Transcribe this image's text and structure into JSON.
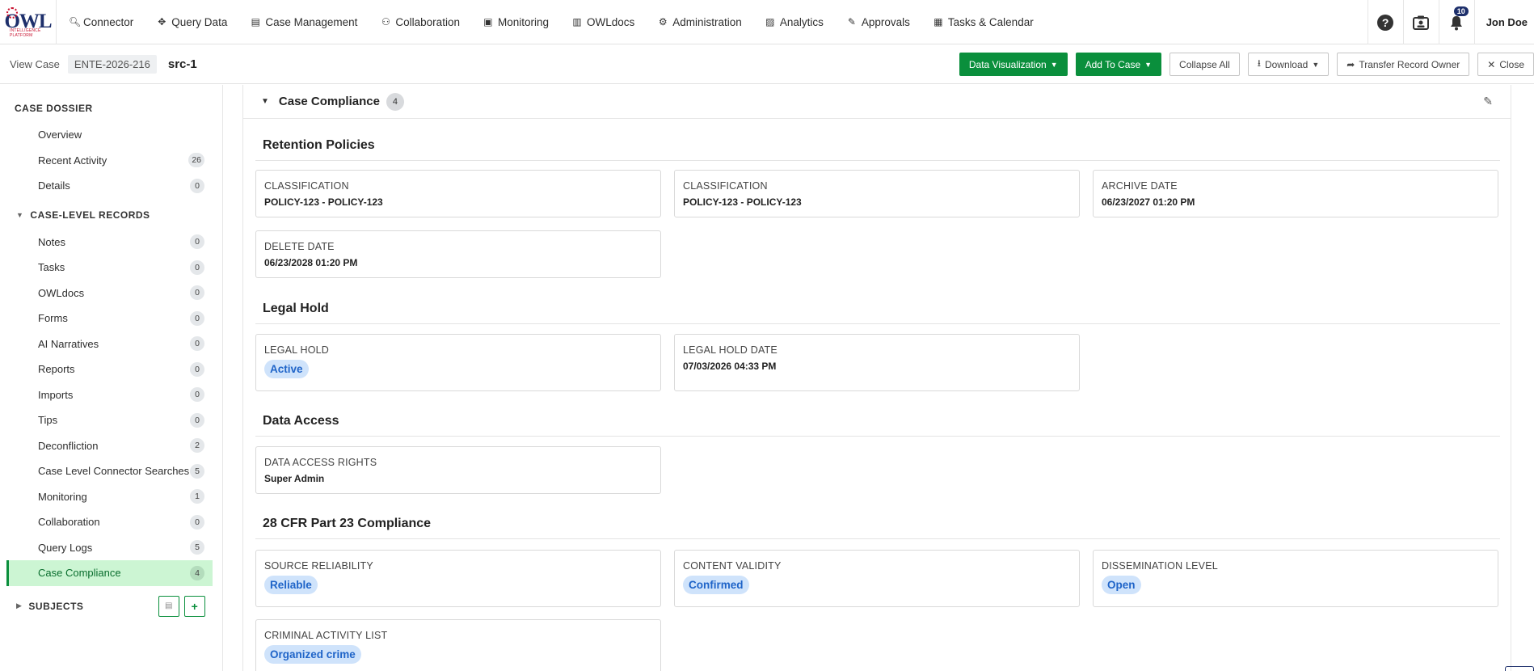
{
  "topnav": {
    "logo_text": "OWL",
    "logo_sub": "INTELLIGENCE PLATFORM",
    "items": [
      {
        "label": "Connector",
        "icon": "search-icon"
      },
      {
        "label": "Query Data",
        "icon": "move-icon"
      },
      {
        "label": "Case Management",
        "icon": "folder-icon"
      },
      {
        "label": "Collaboration",
        "icon": "users-icon"
      },
      {
        "label": "Monitoring",
        "icon": "monitor-icon"
      },
      {
        "label": "OWLdocs",
        "icon": "document-icon"
      },
      {
        "label": "Administration",
        "icon": "users-cog-icon"
      },
      {
        "label": "Analytics",
        "icon": "file-chart-icon"
      },
      {
        "label": "Approvals",
        "icon": "approval-icon"
      },
      {
        "label": "Tasks & Calendar",
        "icon": "calendar-icon"
      }
    ],
    "help": "?",
    "notification_count": "10",
    "user": "Jon Doe"
  },
  "subbar": {
    "view_case_label": "View Case",
    "case_id": "ENTE-2026-216",
    "case_name": "src-1",
    "actions": {
      "data_visualization": "Data Visualization",
      "add_to_case": "Add To Case",
      "collapse_all": "Collapse All",
      "download": "Download",
      "transfer_owner": "Transfer Record Owner",
      "close": "Close"
    }
  },
  "sidebar": {
    "dossier_heading": "CASE DOSSIER",
    "dossier_items": [
      {
        "label": "Overview",
        "count": ""
      },
      {
        "label": "Recent Activity",
        "count": "26"
      },
      {
        "label": "Details",
        "count": "0"
      }
    ],
    "records_heading": "CASE-LEVEL RECORDS",
    "records_items": [
      {
        "label": "Notes",
        "count": "0"
      },
      {
        "label": "Tasks",
        "count": "0"
      },
      {
        "label": "OWLdocs",
        "count": "0"
      },
      {
        "label": "Forms",
        "count": "0"
      },
      {
        "label": "AI Narratives",
        "count": "0"
      },
      {
        "label": "Reports",
        "count": "0"
      },
      {
        "label": "Imports",
        "count": "0"
      },
      {
        "label": "Tips",
        "count": "0"
      },
      {
        "label": "Deconfliction",
        "count": "2"
      },
      {
        "label": "Case Level Connector Searches",
        "count": "5"
      },
      {
        "label": "Monitoring",
        "count": "1"
      },
      {
        "label": "Collaboration",
        "count": "0"
      },
      {
        "label": "Query Logs",
        "count": "5"
      },
      {
        "label": "Case Compliance",
        "count": "4"
      }
    ],
    "subjects_heading": "SUBJECTS"
  },
  "main": {
    "panel_title": "Case Compliance",
    "panel_count": "4",
    "retention": {
      "title": "Retention Policies",
      "cards": [
        {
          "label": "CLASSIFICATION",
          "value": "POLICY-123 - POLICY-123"
        },
        {
          "label": "CLASSIFICATION",
          "value": "POLICY-123 - POLICY-123"
        },
        {
          "label": "ARCHIVE DATE",
          "value": "06/23/2027 01:20 PM"
        },
        {
          "label": "DELETE DATE",
          "value": "06/23/2028 01:20 PM"
        }
      ]
    },
    "legal_hold": {
      "title": "Legal Hold",
      "hold_label": "LEGAL HOLD",
      "hold_value": "Active",
      "date_label": "LEGAL HOLD DATE",
      "date_value": "07/03/2026 04:33 PM"
    },
    "data_access": {
      "title": "Data Access",
      "label": "DATA ACCESS RIGHTS",
      "value": "Super Admin"
    },
    "cfr": {
      "title": "28 CFR Part 23 Compliance",
      "source_label": "SOURCE RELIABILITY",
      "source_value": "Reliable",
      "content_label": "CONTENT VALIDITY",
      "content_value": "Confirmed",
      "dissem_label": "DISSEMINATION LEVEL",
      "dissem_value": "Open",
      "criminal_label": "CRIMINAL ACTIVITY LIST",
      "criminal_value": "Organized crime"
    }
  },
  "colors": {
    "accent_green": "#0a8f3c",
    "pill_blue": "#1f64c8",
    "brand_navy": "#1d2f6b"
  }
}
